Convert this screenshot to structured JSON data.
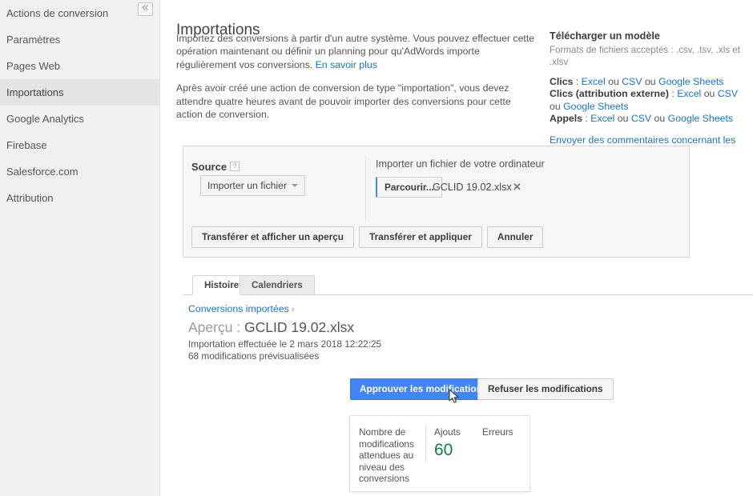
{
  "sidebar": {
    "collapse_icon": "chevrons-left-icon",
    "items": [
      {
        "label": "Actions de conversion",
        "active": false
      },
      {
        "label": "Paramètres",
        "active": false
      },
      {
        "label": "Pages Web",
        "active": false
      },
      {
        "label": "Importations",
        "active": true
      },
      {
        "label": "Google Analytics",
        "active": false
      },
      {
        "label": "Firebase",
        "active": false
      },
      {
        "label": "Salesforce.com",
        "active": false
      },
      {
        "label": "Attribution",
        "active": false
      }
    ]
  },
  "page": {
    "title": "Importations",
    "intro_p1_text": "Importez des conversions à partir d'un autre système. Vous pouvez effectuer cette opération maintenant ou définir un planning pour qu'AdWords importe régulièrement vos conversions. ",
    "intro_p1_link": "En savoir plus",
    "intro_p2": "Après avoir créé une action de conversion de type \"importation\", vous devez attendre quatre heures avant de pouvoir importer des conversions pour cette action de conversion."
  },
  "template_panel": {
    "title": "Télécharger un modèle",
    "formats": "Formats de fichiers acceptés : .csv, .tsv, .xls et .xlsv",
    "rows": [
      {
        "label": "Clics",
        "sep": " : ",
        "links": [
          "Excel",
          "CSV",
          "Google Sheets"
        ],
        "joiner": " ou "
      },
      {
        "label": "Clics (attribution externe)",
        "sep": " : ",
        "links": [
          "Excel",
          "CSV",
          "Google Sheets"
        ],
        "joiner": " ou "
      },
      {
        "label": "Appels",
        "sep": " : ",
        "links": [
          "Excel",
          "CSV",
          "Google Sheets"
        ],
        "joiner": " ou "
      }
    ],
    "feedback_link": "Envoyer des commentaires concernant les transferts"
  },
  "source_panel": {
    "source_label": "Source",
    "help_icon": "question-mark-icon",
    "source_value": "Importer un fichier",
    "upload_label": "Importer un fichier de votre ordinateur",
    "browse_label": "Parcourir...",
    "file_name": "GCLID 19.02.xlsx",
    "remove_icon": "close-icon",
    "actions": [
      "Transférer et afficher un aperçu",
      "Transférer et appliquer",
      "Annuler"
    ]
  },
  "tabs": [
    {
      "label": "Histoire",
      "active": true
    },
    {
      "label": "Calendriers",
      "active": false
    }
  ],
  "history": {
    "breadcrumb": "Conversions importées",
    "breadcrumb_chevron": "chevron-right-icon",
    "preview_prefix": "Aperçu : ",
    "preview_file": "GCLID 19.02.xlsx",
    "import_date": "Importation effectuée le 2 mars 2018 12:22:25",
    "import_changes": "68 modifications prévisualisées",
    "approve_label": "Approuver les modifications",
    "reject_label": "Refuser les modifications"
  },
  "stats": {
    "col_changes_label": "Nombre de modifications attendues au niveau des conversions",
    "col_adds_label": "Ajouts",
    "col_adds_value": "60",
    "col_errors_label": "Erreurs",
    "col_errors_value": ""
  },
  "colors": {
    "accent_blue": "#4285f4",
    "link_blue": "#1a73c8",
    "green": "#0b8043",
    "sidebar_bg": "#f1f1f1",
    "sidebar_active_bg": "#e4e4e4",
    "panel_bg": "#f7f7f7"
  },
  "cursor": {
    "icon": "arrow-pointer-icon"
  }
}
